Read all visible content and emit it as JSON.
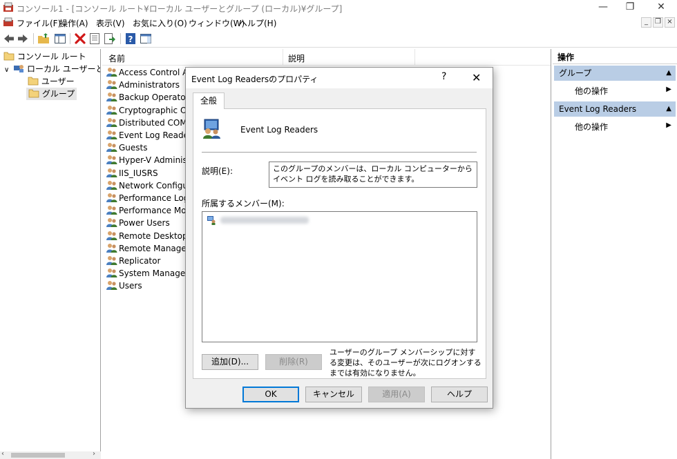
{
  "window": {
    "title": "コンソール1 - [コンソール ルート¥ローカル ユーザーとグループ (ローカル)¥グループ]",
    "minimize": "—",
    "restore": "❐",
    "close": "✕"
  },
  "menu": {
    "items": [
      "ファイル(F)",
      "操作(A)",
      "表示(V)",
      "お気に入り(O)",
      "ウィンドウ(W)",
      "ヘルプ(H)"
    ],
    "mdi_min": "_",
    "mdi_restore": "❐",
    "mdi_close": "×"
  },
  "tree": {
    "root": "コンソール ルート",
    "snapin": "ローカル ユーザーとグル",
    "users": "ユーザー",
    "groups": "グループ"
  },
  "list": {
    "col_name": "名前",
    "col_desc": "説明",
    "rows": [
      "Access Control Assi",
      "Administrators",
      "Backup Operators",
      "Cryptographic Oper",
      "Distributed COM Us",
      "Event Log Readers",
      "Guests",
      "Hyper-V Administra",
      "IIS_IUSRS",
      "Network Configurat",
      "Performance Log U",
      "Performance Monit",
      "Power Users",
      "Remote Desktop Us",
      "Remote Manageme",
      "Replicator",
      "System Managed A",
      "Users"
    ]
  },
  "actions": {
    "header": "操作",
    "section1": "グループ",
    "section1_item": "他の操作",
    "section2": "Event Log Readers",
    "section2_item": "他の操作"
  },
  "dialog": {
    "title": "Event Log Readersのプロパティ",
    "help": "?",
    "close": "✕",
    "tab": "全般",
    "group_name": "Event Log Readers",
    "desc_label": "説明(E):",
    "desc_value": "このグループのメンバーは、ローカル コンピューターからイベント ログを読み取ることができます。",
    "members_label": "所属するメンバー(M):",
    "add_button": "追加(D)...",
    "remove_button": "削除(R)",
    "note": "ユーザーのグループ メンバーシップに対する変更は、そのユーザーが次にログオンするまでは有効になりません。",
    "ok": "OK",
    "cancel": "キャンセル",
    "apply": "適用(A)",
    "helpbtn": "ヘルプ"
  },
  "colors": {
    "action_section": "#b9cde5",
    "default_button_border": "#0078d7",
    "tree_selection": "#e5e5e5"
  }
}
